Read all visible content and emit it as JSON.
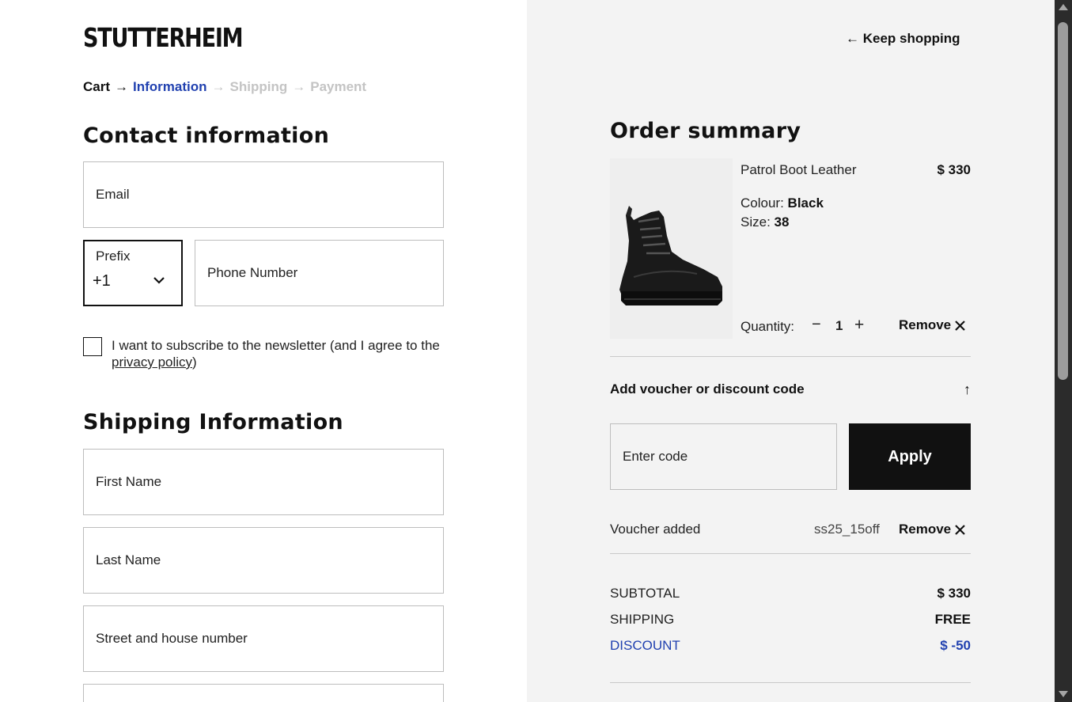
{
  "brand": {
    "logo": "STUTTERHEIM"
  },
  "breadcrumb": {
    "steps": [
      "Cart",
      "Information",
      "Shipping",
      "Payment"
    ],
    "separator": "→"
  },
  "contact": {
    "heading": "Contact information",
    "email_placeholder": "Email",
    "prefix_label": "Prefix",
    "prefix_value": "+1",
    "phone_placeholder": "Phone Number",
    "newsletter_text": "I want to subscribe to the newsletter (and I agree to the",
    "privacy_link": "privacy policy",
    "newsletter_close": ")",
    "newsletter_checked": false
  },
  "shipping": {
    "heading": "Shipping Information",
    "first_name_placeholder": "First Name",
    "last_name_placeholder": "Last Name",
    "street_placeholder": "Street and house number"
  },
  "summary": {
    "keep_shopping": "← Keep shopping",
    "heading": "Order summary",
    "product": {
      "name": "Patrol Boot Leather",
      "price": "$ 330",
      "colour_label": "Colour:",
      "colour_value": "Black",
      "size_label": "Size:",
      "size_value": "38",
      "quantity_label": "Quantity:",
      "quantity_minus": "−",
      "quantity_value": "1",
      "quantity_plus": "+",
      "remove_label": "Remove",
      "image_icon": "black-leather-boot"
    },
    "voucher": {
      "toggle_label": "Add voucher or discount code",
      "toggle_icon": "↑",
      "code_placeholder": "Enter code",
      "apply_label": "Apply",
      "added_label": "Voucher added",
      "added_code": "ss25_15off",
      "remove_label": "Remove"
    },
    "totals": {
      "subtotal_label": "SUBTOTAL",
      "subtotal_value": "$ 330",
      "shipping_label": "SHIPPING",
      "shipping_value": "FREE",
      "discount_label": "DISCOUNT",
      "discount_value": "$ -50"
    }
  },
  "colors": {
    "accent_blue": "#2141b0",
    "inactive_grey": "#c4c4c4",
    "button_black": "#111111",
    "summary_bg": "#f3f3f3"
  }
}
